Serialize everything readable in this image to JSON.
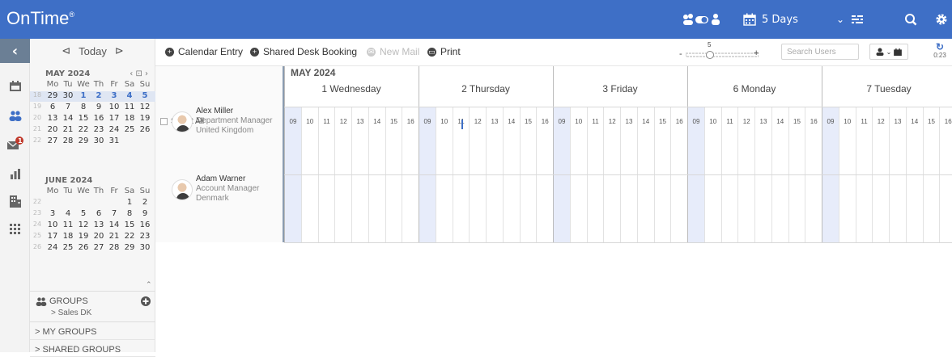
{
  "app": {
    "logo": "OnTime",
    "logo_mark": "®"
  },
  "topbar": {
    "view_label": "5 Days",
    "chevron": "⌄"
  },
  "toolbar": {
    "today": "Today",
    "calendar_entry": "Calendar Entry",
    "shared_desk_booking": "Shared Desk Booking",
    "new_mail": "New Mail",
    "print": "Print",
    "zoom_level": "5",
    "zoom_minus": "-",
    "zoom_plus": "+",
    "search_placeholder": "Search Users",
    "refresh_time": "0:23"
  },
  "mini_calendars": [
    {
      "title": "MAY 2024",
      "weekdays": [
        "Mo",
        "Tu",
        "We",
        "Th",
        "Fr",
        "Sa",
        "Su"
      ],
      "weeks": [
        {
          "wk": "18",
          "days": [
            "29",
            "30",
            "1",
            "2",
            "3",
            "4",
            "5"
          ]
        },
        {
          "wk": "19",
          "days": [
            "6",
            "7",
            "8",
            "9",
            "10",
            "11",
            "12"
          ]
        },
        {
          "wk": "20",
          "days": [
            "13",
            "14",
            "15",
            "16",
            "17",
            "18",
            "19"
          ]
        },
        {
          "wk": "21",
          "days": [
            "20",
            "21",
            "22",
            "23",
            "24",
            "25",
            "26"
          ]
        },
        {
          "wk": "22",
          "days": [
            "27",
            "28",
            "29",
            "30",
            "31",
            "",
            ""
          ]
        }
      ]
    },
    {
      "title": "JUNE 2024",
      "weekdays": [
        "Mo",
        "Tu",
        "We",
        "Th",
        "Fr",
        "Sa",
        "Su"
      ],
      "weeks": [
        {
          "wk": "22",
          "days": [
            "",
            "",
            "",
            "",
            "",
            "1",
            "2"
          ]
        },
        {
          "wk": "23",
          "days": [
            "3",
            "4",
            "5",
            "6",
            "7",
            "8",
            "9"
          ]
        },
        {
          "wk": "24",
          "days": [
            "10",
            "11",
            "12",
            "13",
            "14",
            "15",
            "16"
          ]
        },
        {
          "wk": "25",
          "days": [
            "17",
            "18",
            "19",
            "20",
            "21",
            "22",
            "23"
          ]
        },
        {
          "wk": "26",
          "days": [
            "24",
            "25",
            "26",
            "27",
            "28",
            "29",
            "30"
          ]
        }
      ]
    }
  ],
  "groups": {
    "title": "GROUPS",
    "current": "> Sales DK",
    "my_groups": "> MY GROUPS",
    "shared_groups": "> SHARED GROUPS"
  },
  "schedule": {
    "month": "MAY 2024",
    "select_all": "Select All",
    "days": [
      "1 Wednesday",
      "2 Thursday",
      "3 Friday",
      "6 Monday",
      "7 Tuesday"
    ],
    "hours": [
      "09",
      "10",
      "11",
      "12",
      "13",
      "14",
      "15",
      "16"
    ],
    "users": [
      {
        "name": "Alex Miller",
        "title": "Department Manager",
        "country": "United Kingdom"
      },
      {
        "name": "Adam Warner",
        "title": "Account Manager",
        "country": "Denmark"
      }
    ]
  },
  "notifications": {
    "mail_badge": "1"
  },
  "colors": {
    "brand": "#3e6fc6",
    "shade": "#e7ecfa",
    "badge": "#c0392b"
  }
}
